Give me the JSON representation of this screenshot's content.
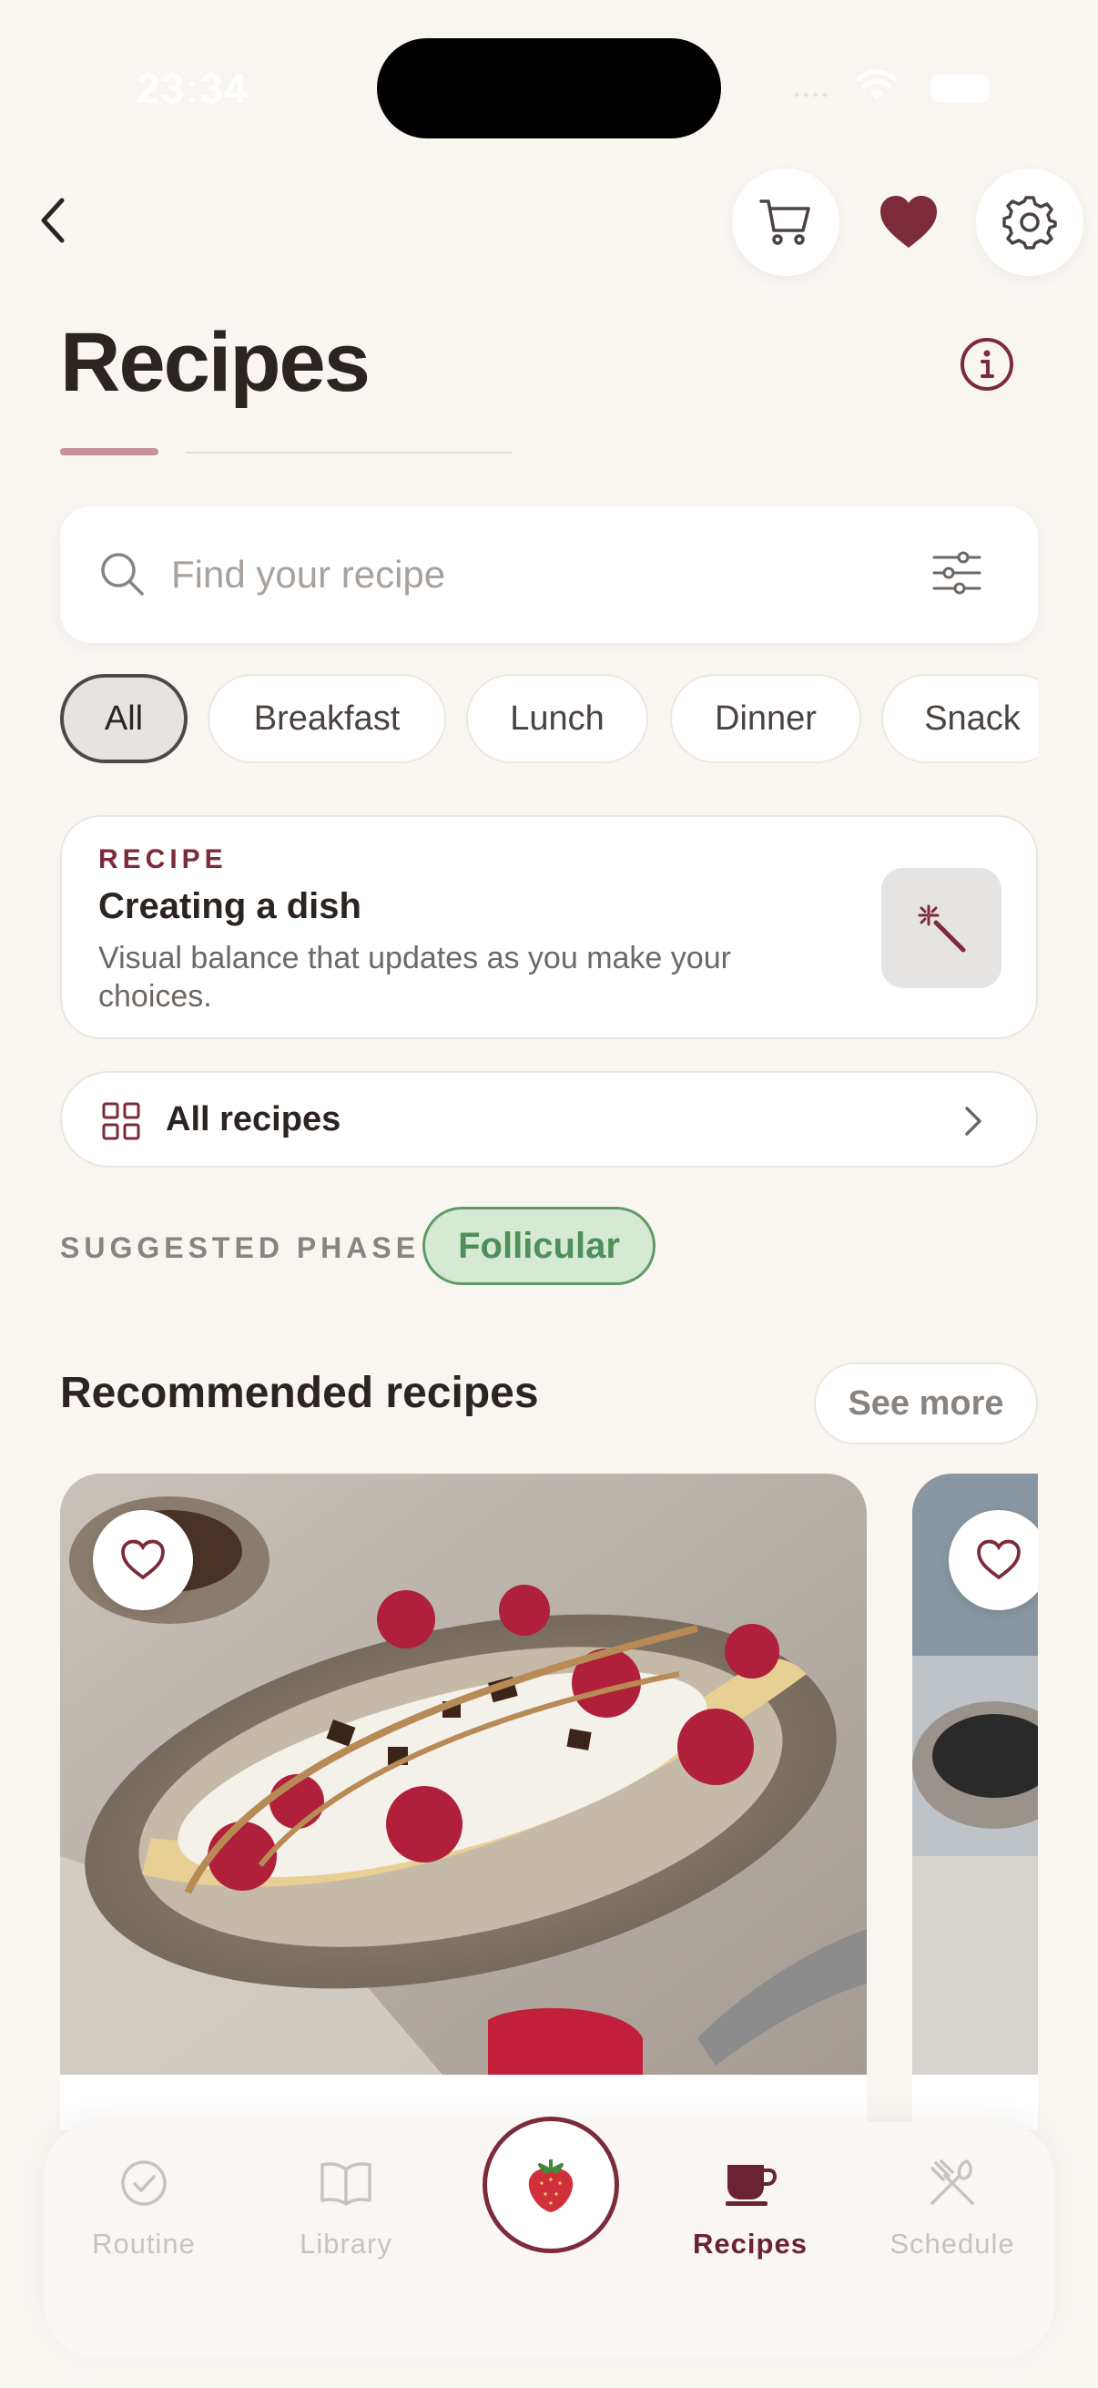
{
  "status_bar": {
    "time": "23:34"
  },
  "header": {
    "back_icon": "chevron-left-icon",
    "cart_icon": "shopping-cart-icon",
    "favorites_icon": "heart-icon",
    "settings_icon": "gear-icon",
    "title": "Recipes",
    "info_icon": "info-icon"
  },
  "search": {
    "placeholder": "Find your recipe",
    "value": "",
    "filter_icon": "sliders-icon"
  },
  "categories": [
    {
      "label": "All",
      "active": true
    },
    {
      "label": "Breakfast",
      "active": false
    },
    {
      "label": "Lunch",
      "active": false
    },
    {
      "label": "Dinner",
      "active": false
    },
    {
      "label": "Snack",
      "active": false
    }
  ],
  "feature_card": {
    "kicker": "RECIPE",
    "title": "Creating a dish",
    "description": "Visual balance that updates as you make your choices.",
    "action_icon": "magic-wand-icon"
  },
  "all_recipes": {
    "label": "All recipes"
  },
  "phase": {
    "label": "SUGGESTED PHASE",
    "value": "Follicular"
  },
  "recommended": {
    "title": "Recommended recipes",
    "see_more": "See more",
    "cards": [
      {
        "image": "banana-split-yogurt-berries-chocolate",
        "favorited": false
      },
      {
        "image": "chia-seed-bowl",
        "favorited": false
      }
    ]
  },
  "tab_bar": {
    "tabs": [
      {
        "label": "Routine",
        "icon": "check-circle-icon",
        "active": false
      },
      {
        "label": "Library",
        "icon": "book-open-icon",
        "active": false
      },
      {
        "label": "Recipes",
        "icon": "coffee-cup-icon",
        "active": true
      },
      {
        "label": "Schedule",
        "icon": "utensils-icon",
        "active": false
      }
    ],
    "center_icon": "strawberry-icon"
  },
  "colors": {
    "background": "#f9f6f2",
    "accent": "#7c2b3a",
    "phase_green": "#4f8f5a",
    "phase_bg": "#d6ead3"
  }
}
